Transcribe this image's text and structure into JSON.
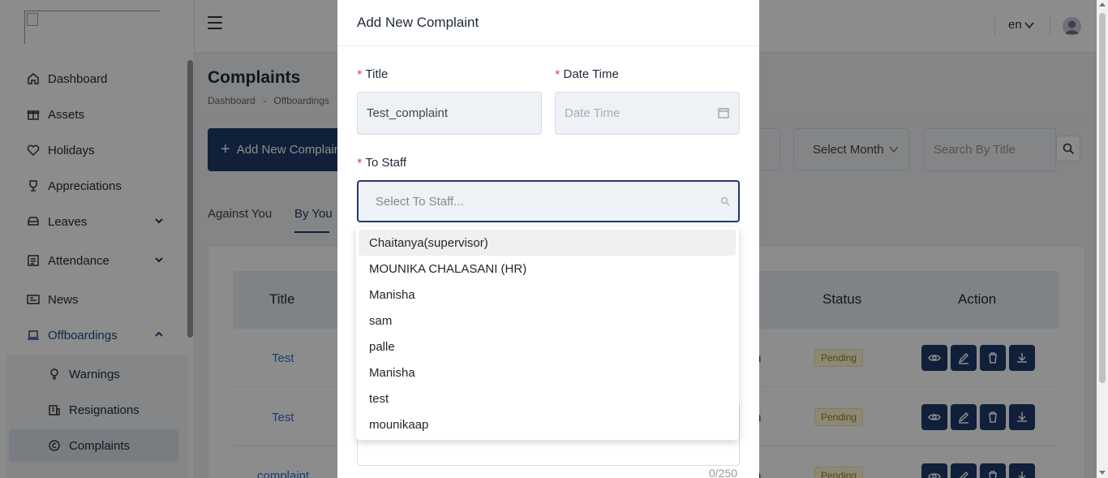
{
  "sidebar": {
    "items": [
      {
        "label": "Dashboard",
        "icon": "home-icon"
      },
      {
        "label": "Assets",
        "icon": "gift-icon"
      },
      {
        "label": "Holidays",
        "icon": "heart-icon"
      },
      {
        "label": "Appreciations",
        "icon": "trophy-icon"
      },
      {
        "label": "Leaves",
        "icon": "car-icon"
      },
      {
        "label": "Attendance",
        "icon": "list-icon"
      },
      {
        "label": "News",
        "icon": "newspaper-icon"
      },
      {
        "label": "Offboardings",
        "icon": "laptop-icon"
      }
    ],
    "subitems": [
      {
        "label": "Warnings",
        "icon": "bulb-icon"
      },
      {
        "label": "Resignations",
        "icon": "building-icon"
      },
      {
        "label": "Complaints",
        "icon": "copyright-icon"
      }
    ]
  },
  "header": {
    "language": "en"
  },
  "page": {
    "title": "Complaints",
    "breadcrumb": [
      "Dashboard",
      "-",
      "Offboardings"
    ],
    "add_button": "Add New Complain",
    "month_select": "Select Month",
    "search_placeholder": "Search By Title",
    "tabs": [
      "Against You",
      "By You"
    ],
    "table": {
      "headers": [
        "Title",
        "Status",
        "Action"
      ],
      "rows": [
        {
          "title": "Test",
          "clip": "n",
          "status": "Pending"
        },
        {
          "title": "Test",
          "clip": "n",
          "status": "Pending"
        },
        {
          "title": "complaint",
          "clip": "n",
          "status": "Pending"
        }
      ]
    }
  },
  "modal": {
    "title": "Add New Complaint",
    "required_mark": "*",
    "title_label": "Title",
    "title_value": "Test_complaint",
    "datetime_label": "Date Time",
    "datetime_placeholder": "Date Time",
    "staff_label": "To Staff",
    "staff_placeholder": "Select To Staff...",
    "counter": "0/250",
    "staff_options": [
      "Chaitanya(supervisor)",
      "MOUNIKA CHALASANI (HR)",
      "Manisha",
      "sam",
      "palle",
      "Manisha",
      "test",
      "mounikaap"
    ]
  },
  "colors": {
    "primary": "#1e3a6b",
    "link": "#2e6fd1",
    "required": "#e03131",
    "badge_bg": "#fef8d6",
    "badge_text": "#a07c17"
  }
}
